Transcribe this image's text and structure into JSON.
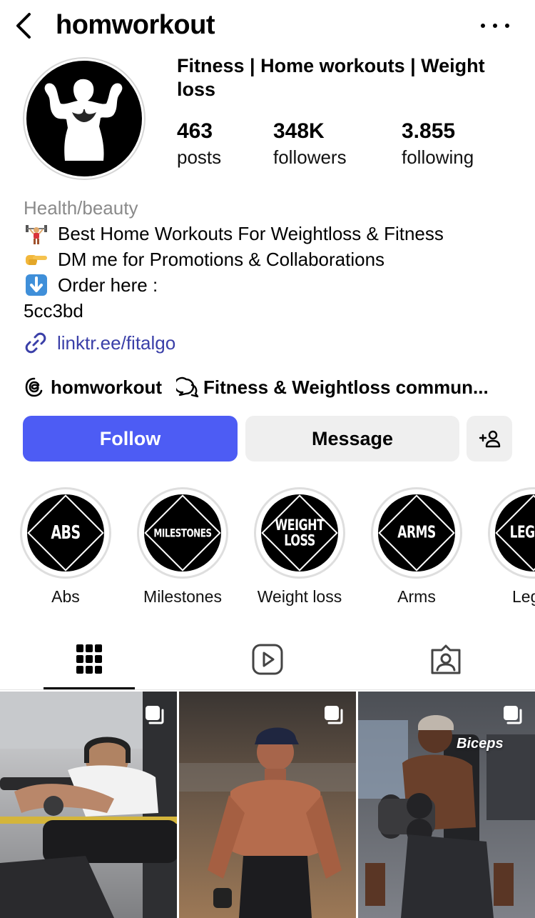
{
  "header": {
    "username": "homworkout",
    "back_icon": "chevron-left-icon",
    "more_icon": "more-horizontal-icon"
  },
  "profile": {
    "full_name": "Fitness | Home workouts | Weight loss",
    "stats": [
      {
        "value": "463",
        "label": "posts"
      },
      {
        "value": "348K",
        "label": "followers"
      },
      {
        "value": "3.855",
        "label": "following"
      }
    ],
    "category": "Health/beauty",
    "bio": [
      {
        "emoji": "weightlifter-emoji",
        "text": "Best Home Workouts For Weightloss & Fitness"
      },
      {
        "emoji": "pointing-hand-emoji",
        "text": "DM me for Promotions & Collaborations"
      },
      {
        "emoji": "down-arrow-emoji",
        "text": "Order here :"
      },
      {
        "emoji": "",
        "text": "5cc3bd"
      }
    ],
    "link": "linktr.ee/fitalgo",
    "threads_handle": "homworkout",
    "community": "Fitness & Weightloss commun..."
  },
  "actions": {
    "follow_label": "Follow",
    "message_label": "Message",
    "follow_color": "#4d5cf4"
  },
  "highlights": [
    {
      "cover_text": "ABS",
      "label": "Abs"
    },
    {
      "cover_text": "MILESTONES",
      "label": "Milestones"
    },
    {
      "cover_text": "WEIGHT LOSS",
      "label": "Weight loss"
    },
    {
      "cover_text": "ARMS",
      "label": "Arms"
    },
    {
      "cover_text": "LEGS",
      "label": "Legs"
    }
  ],
  "tabs": [
    {
      "icon": "grid-icon",
      "active": true
    },
    {
      "icon": "reels-icon",
      "active": false
    },
    {
      "icon": "tagged-icon",
      "active": false
    }
  ],
  "posts": [
    {
      "caption": "",
      "multi": true
    },
    {
      "caption": "",
      "multi": true
    },
    {
      "caption": "Biceps",
      "multi": true
    }
  ]
}
